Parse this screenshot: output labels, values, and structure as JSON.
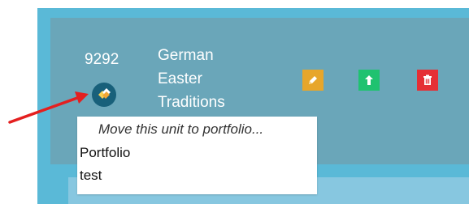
{
  "unit": {
    "id": "9292",
    "title_lines": [
      "German",
      "Easter",
      "Traditions"
    ]
  },
  "actions": {
    "edit_icon": "pencil-icon",
    "upload_icon": "arrow-up-icon",
    "delete_icon": "trash-icon",
    "colors": {
      "edit": "#e7a62b",
      "upload": "#1fc270",
      "delete": "#e52f35"
    }
  },
  "move_menu": {
    "icon": "move-unit-icon",
    "header": "Move this unit to portfolio...",
    "options": [
      "Portfolio",
      "test"
    ]
  },
  "annotation": {
    "color": "#e41f1f"
  }
}
